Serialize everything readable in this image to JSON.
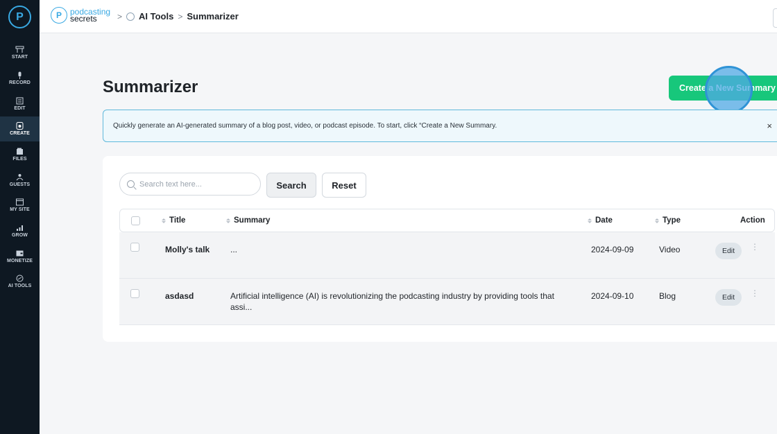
{
  "sidebar": {
    "logo_glyph": "P",
    "items": [
      {
        "label": "START",
        "icon": "home-icon",
        "active": false
      },
      {
        "label": "RECORD",
        "icon": "microphone-icon",
        "active": false
      },
      {
        "label": "EDIT",
        "icon": "edit-icon",
        "active": false
      },
      {
        "label": "CREATE",
        "icon": "create-icon",
        "active": true
      },
      {
        "label": "FILES",
        "icon": "folder-icon",
        "active": false
      },
      {
        "label": "GUESTS",
        "icon": "guests-icon",
        "active": false
      },
      {
        "label": "MY SITE",
        "icon": "website-icon",
        "active": false
      },
      {
        "label": "GROW",
        "icon": "chart-icon",
        "active": false
      },
      {
        "label": "MONETIZE",
        "icon": "wallet-icon",
        "active": false
      },
      {
        "label": "AI TOOLS",
        "icon": "ai-icon",
        "active": false
      }
    ]
  },
  "header": {
    "brand_line1": "podcasting",
    "brand_line2": "secrets",
    "breadcrumb": [
      ">",
      "AI Tools",
      ">",
      "Summarizer"
    ]
  },
  "main": {
    "title": "Summarizer",
    "create_button": "Create a New Summary",
    "banner": "Quickly generate an AI-generated summary of a blog post, video, or podcast episode. To start, click “Create a New Summary.",
    "banner_close": "×",
    "search_placeholder": "Search text here...",
    "search_button": "Search",
    "reset_button": "Reset",
    "columns": {
      "title": "Title",
      "summary": "Summary",
      "date": "Date",
      "type": "Type",
      "action": "Action"
    },
    "rows": [
      {
        "title": "Molly's talk",
        "summary": "...",
        "date": "2024-09-09",
        "type": "Video",
        "action": "Edit",
        "more": "⋮"
      },
      {
        "title": "asdasd",
        "summary": "Artificial intelligence (AI) is revolutionizing the podcasting industry by providing tools that assi...",
        "date": "2024-09-10",
        "type": "Blog",
        "action": "Edit",
        "more": "⋮"
      }
    ]
  },
  "colors": {
    "sidebar_bg": "#0e1822",
    "accent_blue": "#39a9e3",
    "create_green": "#17c77b",
    "banner_border": "#5fb8db"
  }
}
